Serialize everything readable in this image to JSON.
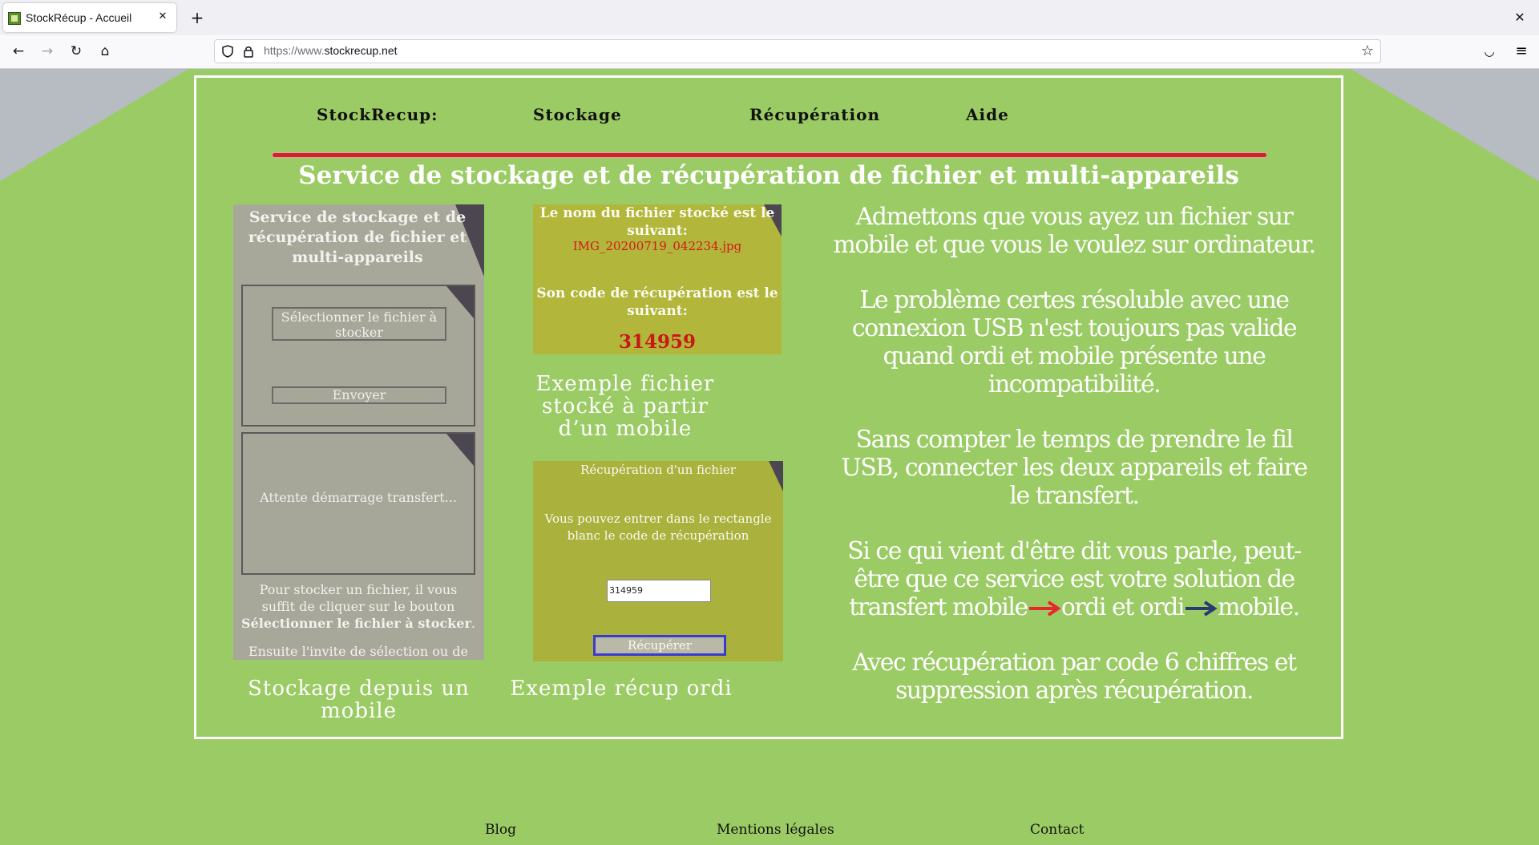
{
  "browser": {
    "tab_title": "StockRécup - Accueil",
    "url_prefix": "https://www.",
    "url_domain": "stockrecup.net"
  },
  "nav": {
    "brand": "StockRecup:",
    "storage": "Stockage",
    "recovery": "Récupération",
    "help": "Aide"
  },
  "headline": "Service de stockage et de récupération de fichier et multi-appareils",
  "mobile_screen": {
    "title": "Service de stockage et de récupération de fichier et multi-appareils",
    "select_button": "Sélectionner le fichier à stocker",
    "send_button": "Envoyer",
    "waiting": "Attente démarrage transfert...",
    "help_text": "Pour stocker un fichier, il vous suffit de cliquer sur le bouton",
    "help_bold": "Sélectionner le fichier à stocker",
    "help_end": ".",
    "help_cut": "Ensuite l'invite de sélection ou de"
  },
  "stored_screen": {
    "line1": "Le nom du fichier stocké est le suivant:",
    "filename": "IMG_20200719_042234.jpg",
    "line2": "Son code de récupération est le suivant:",
    "code": "314959"
  },
  "recup_screen": {
    "title": "Récupération d'un fichier",
    "info": "Vous pouvez entrer dans le rectangle blanc le code de récupération",
    "input_value": "314959",
    "button": "Récupérer"
  },
  "captions": {
    "mobile": "Stockage depuis un mobile",
    "example": "Exemple fichier stocké à partir d’un mobile",
    "recup": "Exemple récup ordi"
  },
  "explain": {
    "p1": "Admettons que vous ayez un fichier sur mobile et que vous le voulez sur ordinateur.",
    "p2": "Le problème certes résoluble avec une connexion USB n'est toujours pas valide quand ordi et mobile présente une incompatibilité.",
    "p3": "Sans compter le temps de prendre le fil USB, connecter les deux appareils et faire le transfert.",
    "p4_start": "Si ce qui vient d'être dit vous parle, peut-être que ce service est votre solution de transfert mobile",
    "p4_mid": "ordi et ordi",
    "p4_end": "mobile.",
    "p5": "Avec récupération par code 6 chiffres et suppression après récupération."
  },
  "footer": {
    "blog": "Blog",
    "legal": "Mentions légales",
    "contact": "Contact"
  },
  "colors": {
    "page_bg": "#9bcb64",
    "accent_red": "#c8262b",
    "arrow_blue": "#2b3a6e"
  }
}
